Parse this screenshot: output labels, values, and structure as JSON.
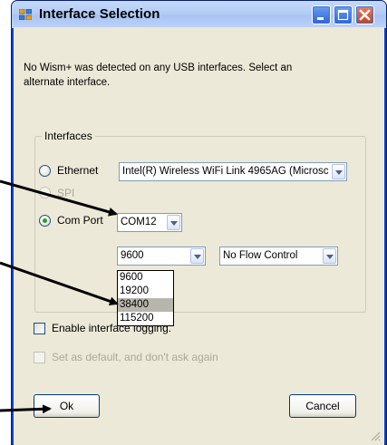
{
  "window": {
    "title": "Interface Selection"
  },
  "message": "No Wism+ was detected on any USB interfaces. Select an alternate interface.",
  "interfaces": {
    "group_label": "Interfaces",
    "ethernet_label": "Ethernet",
    "ethernet_value": "Intel(R) Wireless WiFi Link 4965AG (Microsc",
    "spi_label": "SPI",
    "com_port_label": "Com Port",
    "com_port_value": "COM12",
    "baud_value": "9600",
    "baud_options": [
      "9600",
      "19200",
      "38400",
      "115200"
    ],
    "baud_highlighted": "38400",
    "flow_control_value": "No Flow Control"
  },
  "options": {
    "enable_logging_label": "Enable interface logging.",
    "set_default_label": "Set as default, and don't ask again"
  },
  "buttons": {
    "ok": "Ok",
    "cancel": "Cancel"
  },
  "colors": {
    "titlebar": "#b4cdf6",
    "window_border": "#0b3fd6",
    "client_bg": "#ece9d8",
    "close_button": "#c4401c",
    "dropdown_highlight": "#b8b5ac"
  }
}
